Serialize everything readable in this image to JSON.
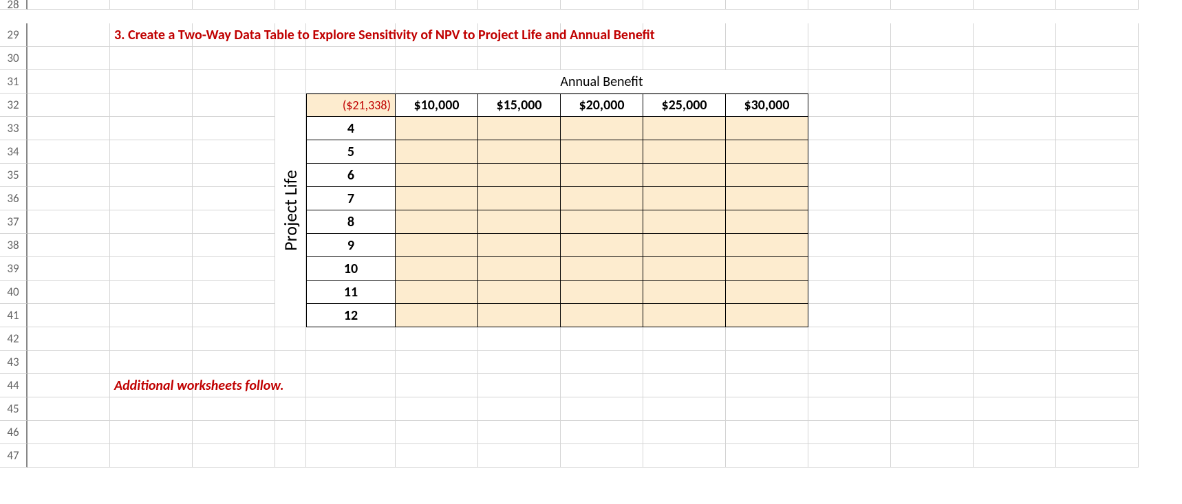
{
  "rows": {
    "r28": "28",
    "r29": "29",
    "r30": "30",
    "r31": "31",
    "r32": "32",
    "r33": "33",
    "r34": "34",
    "r35": "35",
    "r36": "36",
    "r37": "37",
    "r38": "38",
    "r39": "39",
    "r40": "40",
    "r41": "41",
    "r42": "42",
    "r43": "43",
    "r44": "44",
    "r45": "45",
    "r46": "46",
    "r47": "47"
  },
  "title": "3. Create a Two-Way Data Table to Explore Sensitivity of NPV to Project Life and Annual Benefit",
  "colAxisLabel": "Annual Benefit",
  "rowAxisLabel": "Project Life",
  "cornerValue": "($21,338)",
  "colHeaders": {
    "c0": "$10,000",
    "c1": "$15,000",
    "c2": "$20,000",
    "c3": "$25,000",
    "c4": "$30,000"
  },
  "rowHeaders": {
    "r0": "4",
    "r1": "5",
    "r2": "6",
    "r3": "7",
    "r4": "8",
    "r5": "9",
    "r6": "10",
    "r7": "11",
    "r8": "12"
  },
  "footnote": "Additional worksheets follow."
}
